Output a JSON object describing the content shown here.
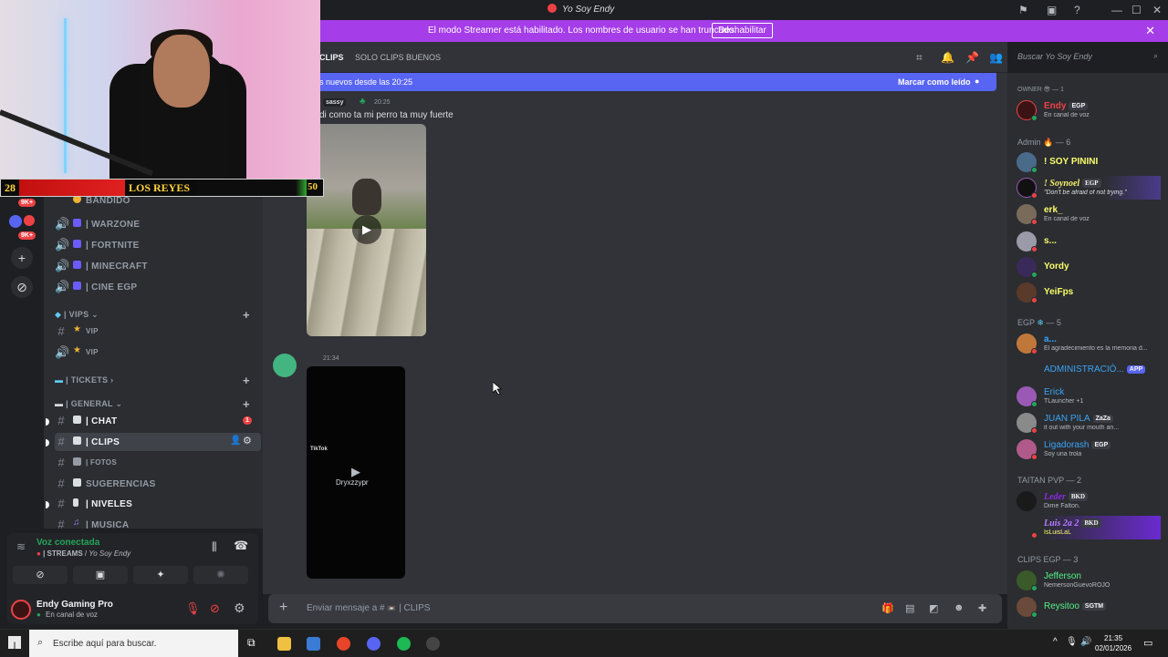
{
  "window": {
    "title": "Yo Soy Endy"
  },
  "banner": {
    "message": "El modo Streamer está habilitado. Los nombres de usuario se han truncado.",
    "disable_label": "Deshabilitar",
    "close_glyph": "✕"
  },
  "overlay": {
    "score_left": "28",
    "team_name": "LOS REYES",
    "score_right": "50"
  },
  "rail": {
    "badge_1": "9K+",
    "badge_2": "9K+"
  },
  "channels": {
    "partial_top": "BANDIDO",
    "voice": [
      {
        "label": "| WARZONE"
      },
      {
        "label": "| FORTNITE"
      },
      {
        "label": "| MINECRAFT"
      },
      {
        "label": "| CINE EGP"
      }
    ],
    "categories": {
      "vips": "| VIPS",
      "tickets": "| TICKETS",
      "general": "| GENERAL"
    },
    "vips": [
      {
        "label": "VIP"
      },
      {
        "label": "VIP"
      }
    ],
    "general": [
      {
        "label": "| CHAT",
        "badge": "1"
      },
      {
        "label": "| CLIPS"
      },
      {
        "label": "| FOTOS"
      },
      {
        "label": "SUGERENCIAS"
      },
      {
        "label": "| NIVELES"
      },
      {
        "label": "| MUSICA"
      }
    ]
  },
  "voice_panel": {
    "title": "Voz conectada",
    "subtitle_channel": "| STREAMS",
    "subtitle_server": "Yo Soy Endy"
  },
  "user_panel": {
    "name": "Endy Gaming Pro",
    "status": "En canal de voz"
  },
  "header": {
    "channel_name": "CLIPS",
    "topic": "SOLO CLIPS BUENOS",
    "search_placeholder": "Buscar Yo Soy Endy"
  },
  "new_messages": {
    "left": "s nuevos desde las 20:25",
    "right": "Marcar como leído"
  },
  "messages": [
    {
      "author": "sassy",
      "time": "20:25",
      "text": "di como ta mi perro ta muy fuerte"
    },
    {
      "author": "",
      "time": "21:34",
      "video_brand": "TikTok",
      "video_user": "Dryxzzypr"
    }
  ],
  "composer": {
    "placeholder_prefix": "Enviar mensaje a #",
    "placeholder_channel": "| CLIPS"
  },
  "members": {
    "groups": [
      {
        "label": "OWNER",
        "count": "— 1"
      },
      {
        "label": "Admin",
        "count": "— 6"
      },
      {
        "label": "EGP",
        "count": "— 5"
      },
      {
        "label": "TAITAN PVP",
        "count": "— 2"
      },
      {
        "label": "CLIPS EGP",
        "count": "— 3"
      }
    ],
    "owner": [
      {
        "name": "Endy",
        "tag": "EGP",
        "sub": "En canal de voz",
        "color": "#ed4245"
      }
    ],
    "admin": [
      {
        "name": "! SOY PININI",
        "tag": "",
        "sub": "",
        "color": "#faff6b"
      },
      {
        "name": "! Soynoel",
        "tag": "EGP",
        "sub": "\"Don't be afraid of not trying.\"",
        "color": "#f5f06b"
      },
      {
        "name": "erk_",
        "tag": "",
        "sub": "En canal de voz",
        "color": "#faff6b"
      },
      {
        "name": "s...",
        "tag": "",
        "sub": "",
        "color": "#faff6b"
      },
      {
        "name": "Yordy",
        "tag": "",
        "sub": "",
        "color": "#faff6b"
      },
      {
        "name": "YeiFps",
        "tag": "",
        "sub": "",
        "color": "#faff6b"
      }
    ],
    "egp": [
      {
        "name": "a...",
        "tag": "",
        "sub": "El agradecimiento es la memoria d...",
        "color": "#3ba4f5"
      },
      {
        "name": "ADMINISTRACIÓ...",
        "tag": "APP",
        "sub": "",
        "color": "#3ba4f5"
      },
      {
        "name": "Erick",
        "tag": "",
        "sub": "TLauncher +1",
        "color": "#3ba4f5"
      },
      {
        "name": "JUAN PILA",
        "tag": "ZaZa",
        "sub": "it out with your mouth an...",
        "color": "#3ba4f5"
      },
      {
        "name": "Ligadorash",
        "tag": "EGP",
        "sub": "Soy una trola",
        "color": "#3ba4f5"
      }
    ],
    "taitan": [
      {
        "name": "Leder",
        "tag": "BKD",
        "sub": "Dime Falton.",
        "color": "#8a2be2"
      },
      {
        "name": "Luis 2a 2",
        "tag": "BKD",
        "sub": "IsLuisLaL",
        "color": "#b77cff"
      }
    ],
    "clips": [
      {
        "name": "Jefferson",
        "tag": "",
        "sub": "NemersonGuevoROJO",
        "color": "#57f287"
      },
      {
        "name": "Reysitoo",
        "tag": "SGTM",
        "sub": "",
        "color": "#57f287"
      }
    ]
  },
  "taskbar": {
    "search_placeholder": "Escribe aquí para buscar.",
    "time": "21:35",
    "date": "02/01/2026"
  }
}
